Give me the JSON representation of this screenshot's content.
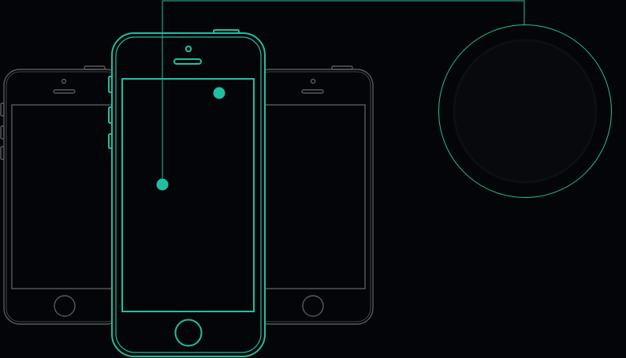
{
  "colors": {
    "background": "#040508",
    "accent": "#1fbfa2",
    "outline_muted": "#5a5a5c",
    "magnifier_fill": "#07090c"
  },
  "illustration": {
    "phones": [
      {
        "role": "left-phone-outline",
        "icon": "smartphone-outline-icon"
      },
      {
        "role": "center-phone-highlighted",
        "icon": "smartphone-outline-icon"
      },
      {
        "role": "right-phone-outline",
        "icon": "smartphone-outline-icon"
      }
    ],
    "touch_points": [
      {
        "role": "touch-point-top-right"
      },
      {
        "role": "touch-point-center-left"
      }
    ],
    "magnifier": {
      "role": "magnifier-circle"
    }
  }
}
